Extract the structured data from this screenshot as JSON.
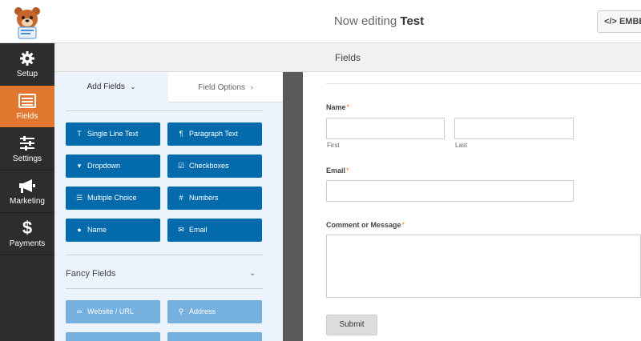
{
  "header": {
    "title_prefix": "Now editing",
    "form_name": "Test",
    "embed_label": "</> EMBED"
  },
  "sidebar": {
    "items": [
      {
        "label": "Setup",
        "icon": "gear-icon"
      },
      {
        "label": "Fields",
        "icon": "fields-icon"
      },
      {
        "label": "Settings",
        "icon": "sliders-icon"
      },
      {
        "label": "Marketing",
        "icon": "megaphone-icon"
      },
      {
        "label": "Payments",
        "icon": "dollar-icon"
      }
    ],
    "active": "Fields"
  },
  "fields_header": "Fields",
  "panel": {
    "tab_add": "Add Fields",
    "tab_options": "Field Options",
    "standard_buttons": [
      {
        "label": "Single Line Text",
        "icon": "text-icon",
        "glyph": "T"
      },
      {
        "label": "Paragraph Text",
        "icon": "paragraph-icon",
        "glyph": "¶"
      },
      {
        "label": "Dropdown",
        "icon": "dropdown-icon",
        "glyph": "▾"
      },
      {
        "label": "Checkboxes",
        "icon": "checkbox-icon",
        "glyph": "☑"
      },
      {
        "label": "Multiple Choice",
        "icon": "list-icon",
        "glyph": "☰"
      },
      {
        "label": "Numbers",
        "icon": "hash-icon",
        "glyph": "#"
      },
      {
        "label": "Name",
        "icon": "user-icon",
        "glyph": "●"
      },
      {
        "label": "Email",
        "icon": "envelope-icon",
        "glyph": "✉"
      }
    ],
    "fancy_title": "Fancy Fields",
    "fancy_buttons": [
      {
        "label": "Website / URL",
        "icon": "link-icon",
        "glyph": "∞"
      },
      {
        "label": "Address",
        "icon": "map-pin-icon",
        "glyph": "⚲"
      }
    ]
  },
  "form": {
    "name_label": "Name",
    "first_label": "First",
    "last_label": "Last",
    "email_label": "Email",
    "comment_label": "Comment or Message",
    "required_mark": "*",
    "submit_label": "Submit"
  },
  "colors": {
    "accent": "#e27730",
    "button_blue": "#036aab",
    "fancy_blue": "#76b0de",
    "nav_bg": "#2d2d2d"
  }
}
